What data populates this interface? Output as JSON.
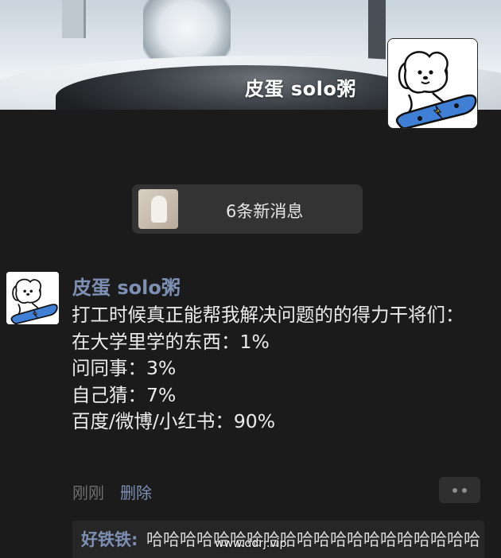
{
  "cover": {
    "name": "皮蛋 solo粥"
  },
  "new_messages": {
    "label": "6条新消息"
  },
  "message": {
    "author": "皮蛋 solo粥",
    "lines": [
      "打工时候真正能帮我解决问题的的得力干将们：",
      "在大学里学的东西：1%",
      "问同事：3%",
      "自己猜：7%",
      "百度/微博/小红书：90%"
    ],
    "time": "刚刚",
    "delete_label": "删除"
  },
  "comment": {
    "name": "好铁铁:",
    "text": "哈哈哈哈哈哈哈哈哈哈哈哈哈哈哈哈哈哈哈哈"
  },
  "watermark": "www.ddrj.vip",
  "colors": {
    "background": "#1b1b1b",
    "name_link": "#7d8fb3",
    "skateboard": "#3f7fd6"
  },
  "icons": {
    "avatar": "puppy-on-skateboard-avatar",
    "more": "more-dots-icon"
  }
}
